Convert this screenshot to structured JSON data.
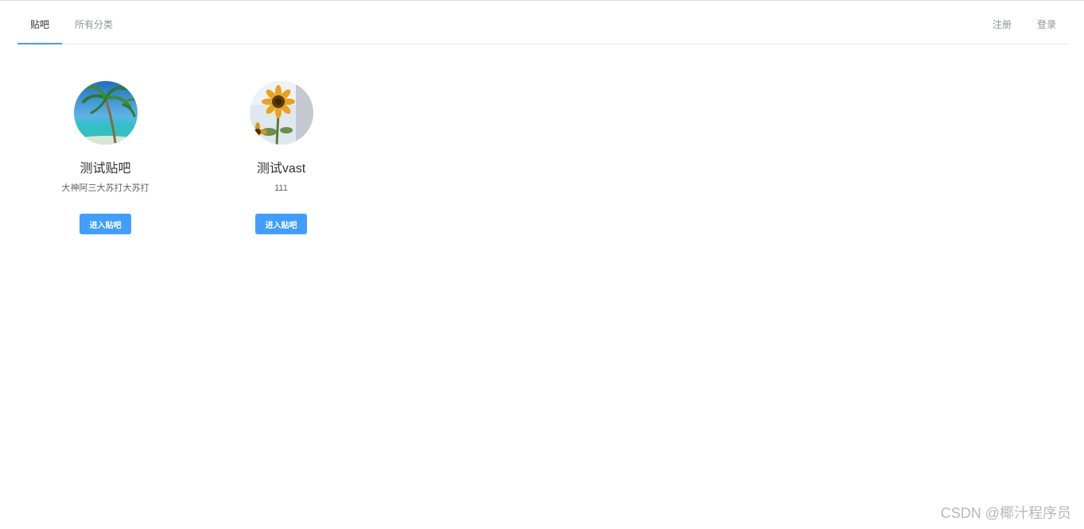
{
  "nav": {
    "left_items": [
      {
        "label": "贴吧",
        "active": true
      },
      {
        "label": "所有分类",
        "active": false
      }
    ],
    "right_items": [
      {
        "label": "注册"
      },
      {
        "label": "登录"
      }
    ]
  },
  "forums": [
    {
      "title": "测试贴吧",
      "description": "大神阿三大苏打大苏打",
      "button_label": "进入贴吧",
      "avatar_icon": "palm-beach-icon"
    },
    {
      "title": "测试vast",
      "description": "111",
      "button_label": "进入贴吧",
      "avatar_icon": "sunflower-icon"
    }
  ],
  "watermark": "CSDN @椰汁程序员",
  "colors": {
    "accent": "#409eff",
    "text_primary": "#303133",
    "text_secondary": "#909399"
  }
}
